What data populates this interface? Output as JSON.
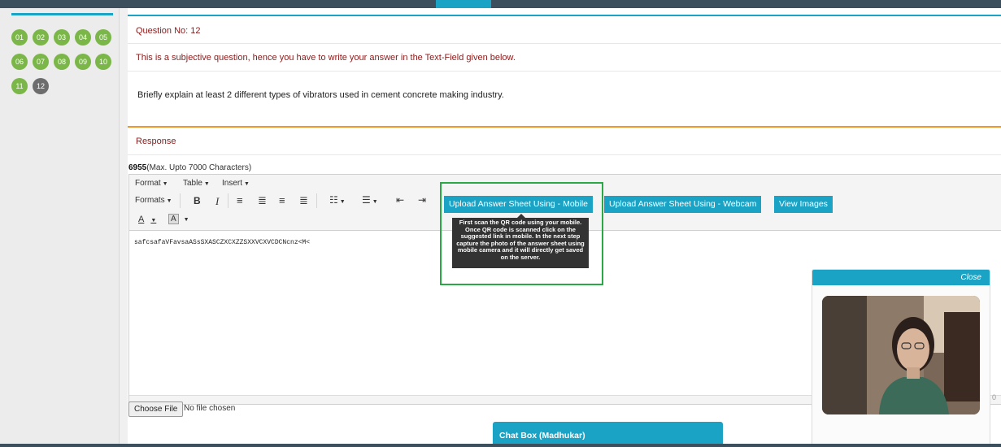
{
  "palette": {
    "questions": [
      "01",
      "02",
      "03",
      "04",
      "05",
      "06",
      "07",
      "08",
      "09",
      "10",
      "11",
      "12"
    ],
    "current": "12"
  },
  "question": {
    "number_label": "Question No: 12",
    "instruction": "This is a subjective question, hence you have to write your answer in the Text-Field given below.",
    "text": "Briefly explain at least 2 different types of vibrators used in cement concrete making industry."
  },
  "response": {
    "heading": "Response",
    "char_count": "6955",
    "char_limit": "(Max. Upto 7000 Characters)"
  },
  "editor": {
    "menus": [
      "Format",
      "Table",
      "Insert"
    ],
    "formats_label": "Formats",
    "bold": "B",
    "italic": "I",
    "font_color": "A",
    "bg_color": "A",
    "content": "safcsafaVFavsaASsSXASCZXCXZZSXXVCXVCDCNcnz<M<"
  },
  "upload": {
    "mobile_button": "Upload Answer Sheet Using - Mobile",
    "webcam_button": "Upload Answer Sheet Using - Webcam",
    "view_images_button": "View Images",
    "tooltip": "First scan the QR code using your mobile. Once QR code is scanned click on the suggested link in mobile. In the next step capture the photo of the answer sheet using mobile camera and it will directly get saved on the server."
  },
  "file": {
    "choose_label": "Choose File",
    "status": "No file chosen"
  },
  "chat": {
    "title": "Chat Box (Madhukar)"
  },
  "video": {
    "close_label": "Close"
  },
  "scroll_label": "0",
  "colors": {
    "accent": "#1ba3c6",
    "answered": "#7ab648",
    "current": "#6d6d6d",
    "highlight": "#2aa845",
    "orange": "#f0962a",
    "heading_red": "#8b1a1a"
  }
}
